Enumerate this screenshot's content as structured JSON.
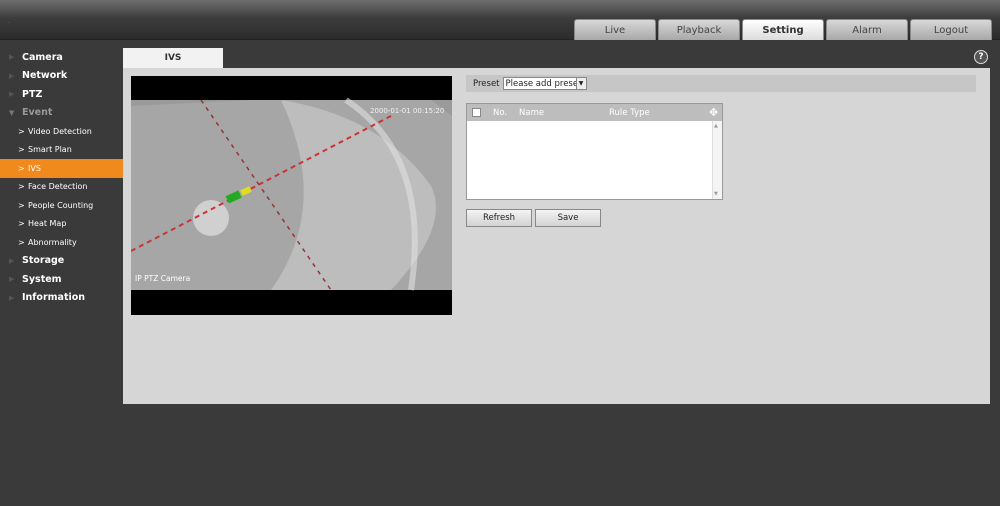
{
  "header": {
    "tabs": [
      {
        "label": "Live"
      },
      {
        "label": "Playback"
      },
      {
        "label": "Setting"
      },
      {
        "label": "Alarm"
      },
      {
        "label": "Logout"
      }
    ],
    "active_tab": "Setting"
  },
  "sidebar": {
    "items": [
      {
        "label": "Camera"
      },
      {
        "label": "Network"
      },
      {
        "label": "PTZ"
      },
      {
        "label": "Event"
      }
    ],
    "event_sub": [
      {
        "label": "Video Detection"
      },
      {
        "label": "Smart Plan"
      },
      {
        "label": "IVS"
      },
      {
        "label": "Face Detection"
      },
      {
        "label": "People Counting"
      },
      {
        "label": "Heat Map"
      },
      {
        "label": "Abnormality"
      }
    ],
    "items_after": [
      {
        "label": "Storage"
      },
      {
        "label": "System"
      },
      {
        "label": "Information"
      }
    ]
  },
  "content": {
    "tab_label": "IVS",
    "help_glyph": "?",
    "video": {
      "timestamp": "2000-01-01 00:15:20",
      "camera_name": "IP PTZ Camera"
    },
    "preset": {
      "label": "Preset",
      "value": "Please add preset"
    },
    "table": {
      "col_no": "No.",
      "col_name": "Name",
      "col_type": "Rule Type",
      "add_glyph": "✥"
    },
    "buttons": {
      "refresh": "Refresh",
      "save": "Save"
    }
  },
  "colors": {
    "accent": "#f08a1d",
    "panel": "#d6d6d6",
    "background": "#3a3a3a"
  }
}
